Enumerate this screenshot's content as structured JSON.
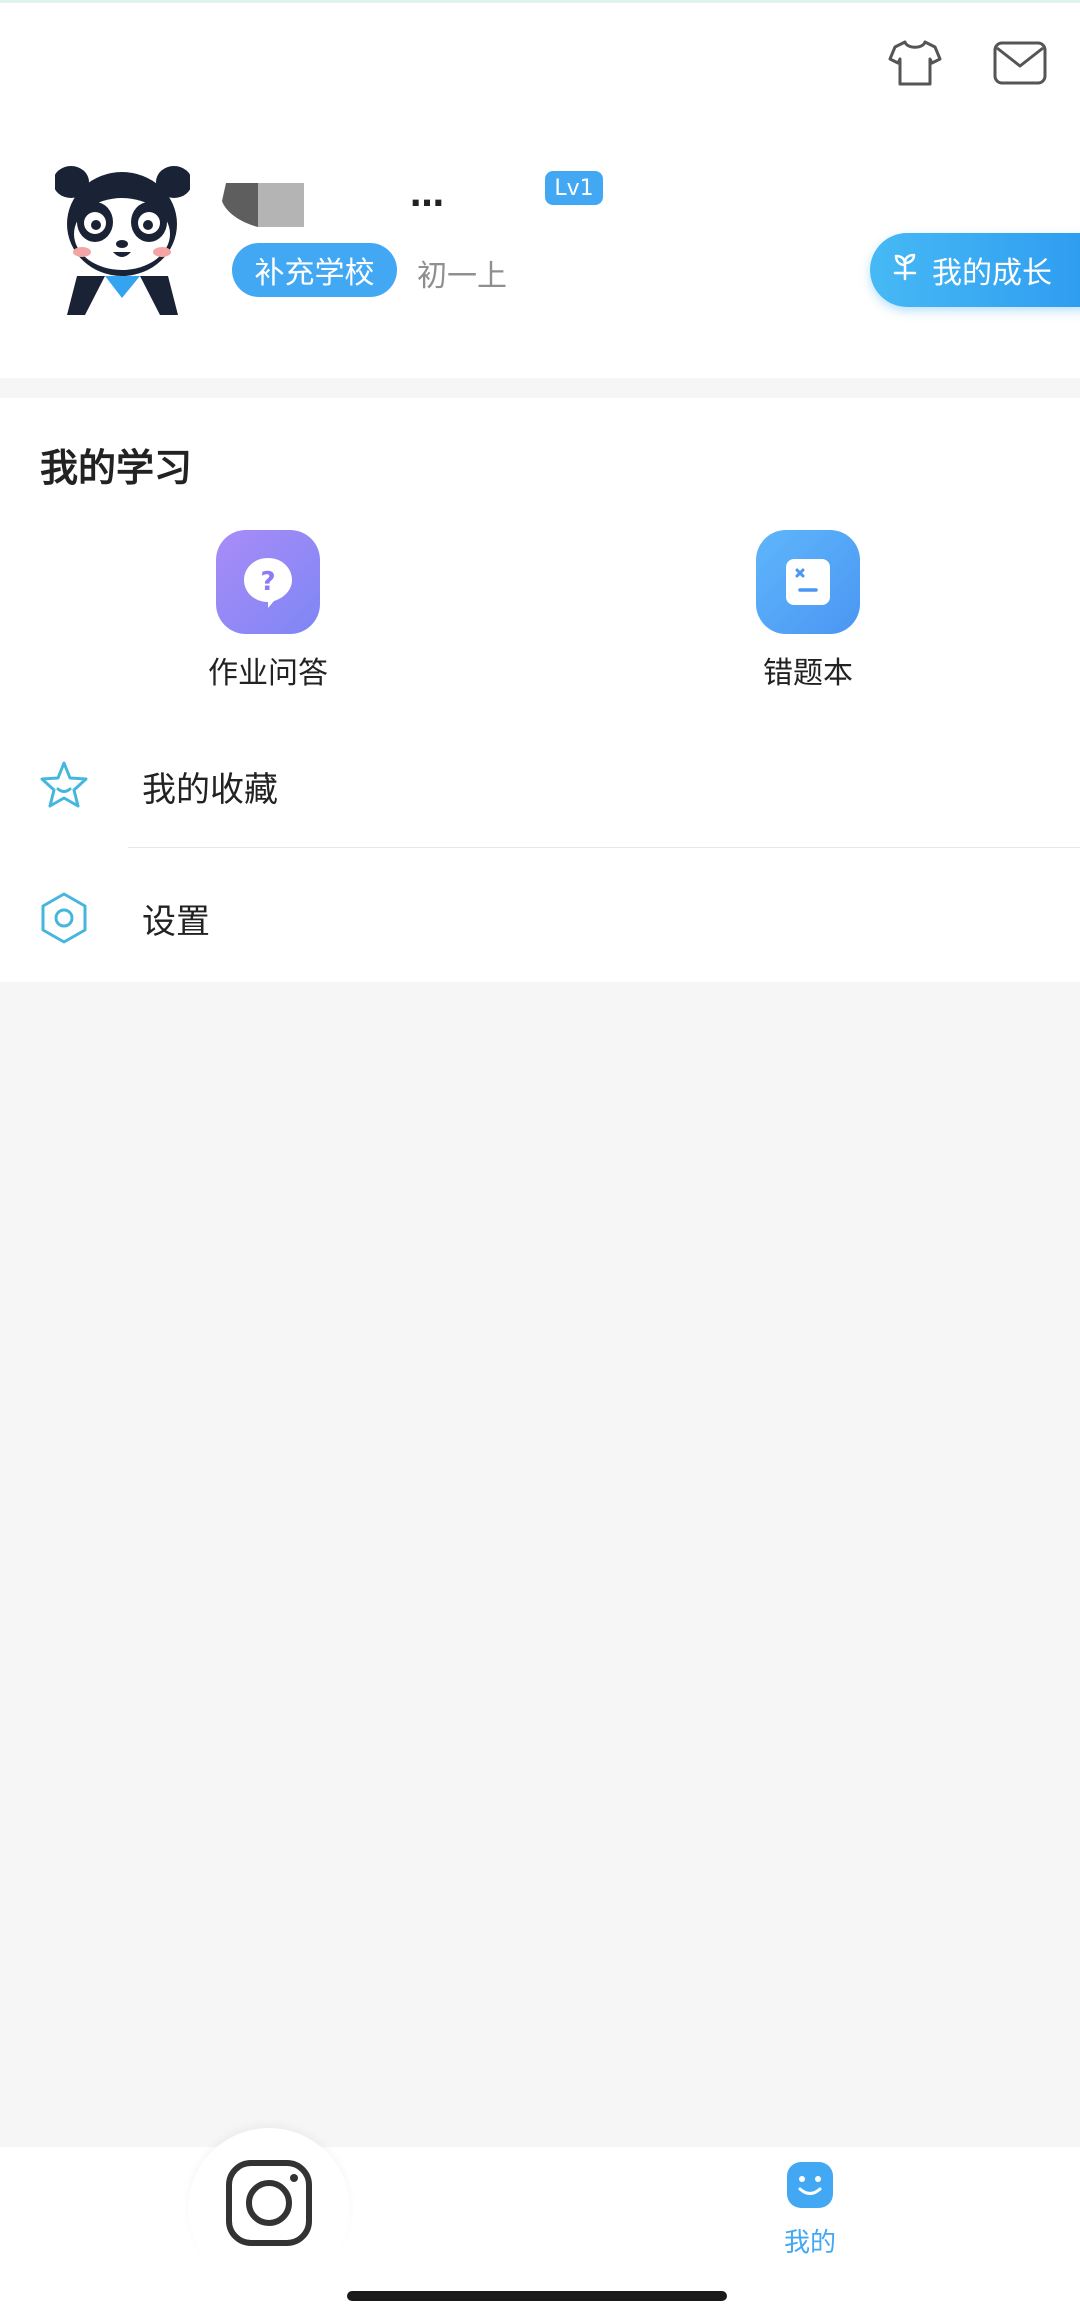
{
  "header": {
    "user_name_visible": "…",
    "level": "Lv1",
    "school_chip": "补充学校",
    "grade": "初一上",
    "growth_button": "我的成长"
  },
  "icons": {
    "top_right": [
      "tshirt-icon",
      "mail-icon"
    ],
    "growth": "sprout-icon",
    "homework": "question-bubble-icon",
    "mistakes": "notebook-icon",
    "favorites": "star-face-icon",
    "settings": "hexagon-gear-icon",
    "camera": "camera-icon",
    "mine": "smiley-face-icon"
  },
  "study": {
    "title": "我的学习",
    "tools": [
      {
        "label": "作业问答"
      },
      {
        "label": "错题本"
      }
    ]
  },
  "menu": [
    {
      "label": "我的收藏"
    },
    {
      "label": "设置"
    }
  ],
  "tabbar": {
    "mine_label": "我的"
  },
  "colors": {
    "accent_blue": "#43a8f4",
    "purple": "#8b7cf5",
    "icon_teal": "#47b6df",
    "background": "#f6f6f6"
  }
}
